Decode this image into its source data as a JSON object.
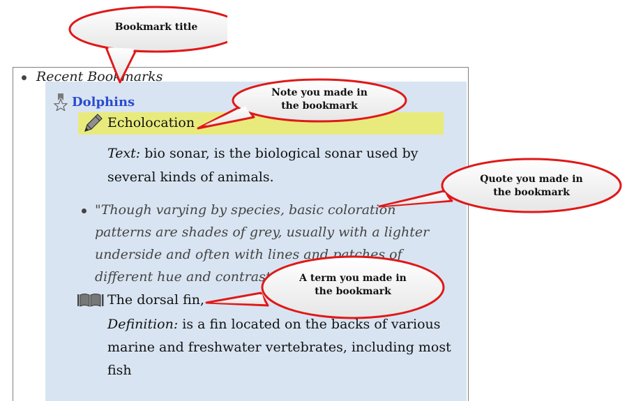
{
  "tree": {
    "root_label": "Recent Bookmarks",
    "bookmark": {
      "title": "Dolphins",
      "note": {
        "title": "Echolocation",
        "text_label": "Text:",
        "text_value": " bio sonar, is the biological sonar used by several kinds of animals."
      },
      "quote": {
        "text": "\"Though varying by species, basic coloration patterns are shades of grey, usually with a lighter underside and often with lines and patches of different hue and contrast."
      },
      "term": {
        "title": "The dorsal fin,",
        "definition_label": "Definition:",
        "definition_value": " is a fin located on the backs of various marine and freshwater vertebrates, including most fish"
      }
    }
  },
  "callouts": {
    "title": "Bookmark title",
    "note_line1": "Note you made in",
    "note_line2": "the bookmark",
    "quote_line1": "Quote you made in",
    "quote_line2": "the bookmark",
    "term_line1": "A term you made in",
    "term_line2": "the bookmark"
  },
  "colors": {
    "callout_border": "#e01818",
    "note_highlight": "#e8eb7c",
    "panel_background": "#d8e4f1",
    "bookmark_title": "#2a4bcf"
  }
}
